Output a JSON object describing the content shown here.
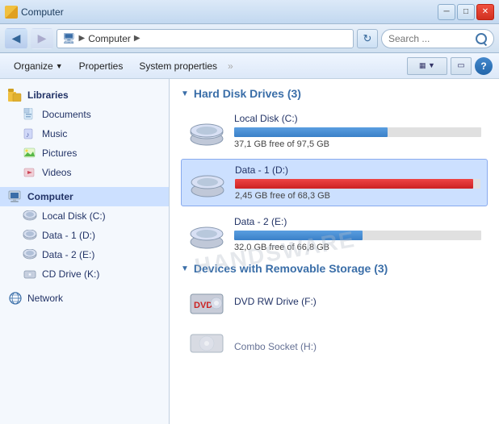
{
  "window": {
    "title": "Computer",
    "controls": {
      "minimize": "─",
      "maximize": "□",
      "close": "✕"
    }
  },
  "addressbar": {
    "back_tooltip": "Back",
    "forward_tooltip": "Forward",
    "path_icon": "▶",
    "path_label": "Computer",
    "path_arrow": "▶",
    "refresh_label": "↻",
    "search_placeholder": "Search ..."
  },
  "toolbar": {
    "organize_label": "Organize",
    "organize_arrow": "▼",
    "properties_label": "Properties",
    "system_properties_label": "System properties",
    "more_label": "»"
  },
  "sidebar": {
    "sections": [
      {
        "items": [
          {
            "id": "libraries",
            "label": "Libraries",
            "icon": "libraries",
            "bold": true
          },
          {
            "id": "documents",
            "label": "Documents",
            "icon": "documents"
          },
          {
            "id": "music",
            "label": "Music",
            "icon": "music"
          },
          {
            "id": "pictures",
            "label": "Pictures",
            "icon": "pictures"
          },
          {
            "id": "videos",
            "label": "Videos",
            "icon": "videos"
          }
        ]
      },
      {
        "items": [
          {
            "id": "computer",
            "label": "Computer",
            "icon": "computer",
            "bold": true,
            "selected": true
          },
          {
            "id": "local-c",
            "label": "Local Disk (C:)",
            "icon": "drive",
            "indent": true
          },
          {
            "id": "data-d",
            "label": "Data - 1 (D:)",
            "icon": "drive",
            "indent": true
          },
          {
            "id": "data-e",
            "label": "Data - 2 (E:)",
            "icon": "drive",
            "indent": true
          },
          {
            "id": "cd-k",
            "label": "CD Drive (K:)",
            "icon": "cdrom",
            "indent": true
          }
        ]
      },
      {
        "items": [
          {
            "id": "network",
            "label": "Network",
            "icon": "network",
            "bold": false
          }
        ]
      }
    ]
  },
  "content": {
    "sections": [
      {
        "id": "hard-disks",
        "title": "Hard Disk Drives (3)",
        "drives": [
          {
            "id": "local-c",
            "name": "Local Disk (C:)",
            "free_gb": 37.1,
            "total_gb": 97.5,
            "free_label": "37,1 GB free of 97,5 GB",
            "bar_pct": 62,
            "bar_color": "blue",
            "selected": false
          },
          {
            "id": "data-d",
            "name": "Data - 1 (D:)",
            "free_gb": 2.45,
            "total_gb": 68.3,
            "free_label": "2,45 GB free of 68,3 GB",
            "bar_pct": 97,
            "bar_color": "red",
            "selected": true
          },
          {
            "id": "data-e",
            "name": "Data - 2 (E:)",
            "free_gb": 32.0,
            "total_gb": 66.8,
            "free_label": "32,0 GB free of 66,8 GB",
            "bar_pct": 52,
            "bar_color": "blue",
            "selected": false
          }
        ]
      },
      {
        "id": "removable",
        "title": "Devices with Removable Storage (3)",
        "drives": [
          {
            "id": "dvd-f",
            "name": "DVD RW Drive (F:)",
            "type": "dvd",
            "selected": false
          }
        ]
      }
    ]
  },
  "watermark": "HANDSWARE"
}
